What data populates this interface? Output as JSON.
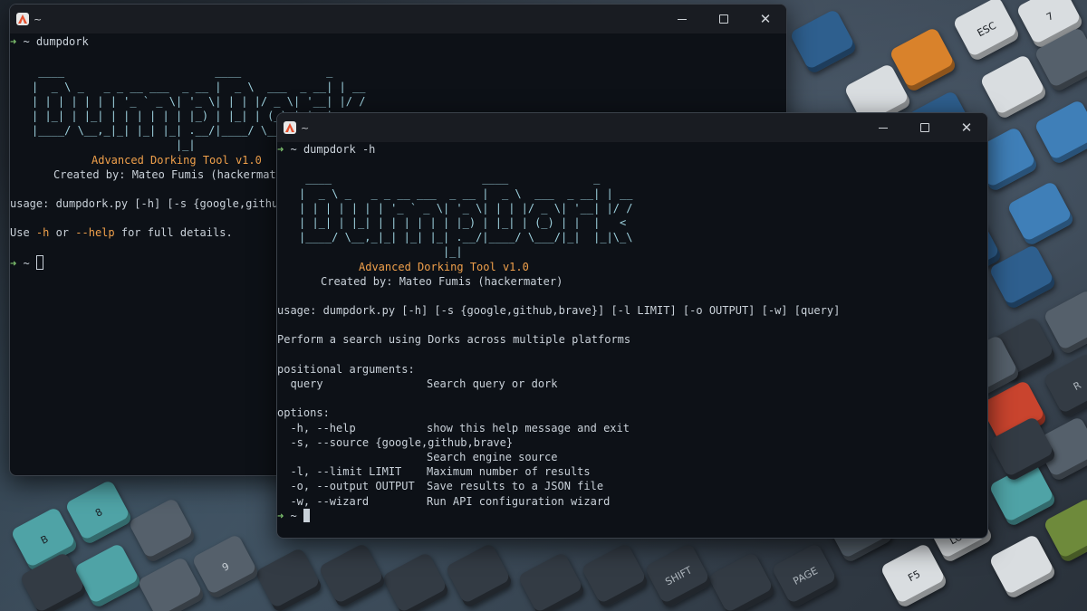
{
  "background": {
    "keys": [
      "ESC",
      "F5",
      "CAPS LOCK",
      "SHIFT",
      "PAGE",
      "R",
      "9",
      "B",
      "8",
      "7"
    ]
  },
  "win1": {
    "title": "~",
    "prompt_arrow": "➜",
    "prompt_tilde": "~",
    "command": "dumpdork",
    "art": [
      " ____                       ____             _",
      "|  _ \\ _   _ _ __ ___  _ __ |  _ \\  ___  _ __| | __",
      "| | | | | | | '_ ` _ \\| '_ \\| | | |/ _ \\| '__| |/ /",
      "| |_| | |_| | | | | | | |_) | |_| | (_) | |  |   <",
      "|____/ \\__,_|_| |_| |_| .__/|____/ \\___/|_|  |_|\\_\\",
      "                      |_|"
    ],
    "tool_name": "Advanced Dorking Tool v1.0",
    "created_by": "Created by: Mateo Fumis (hackermater)",
    "usage": "usage: dumpdork.py [-h] [-s {google,github,brave}] [-l LIMIT] [-o OUTPUT] [-w] [query]",
    "help_pre": "Use ",
    "help_h": "-h",
    "help_or": " or ",
    "help_long": "--help",
    "help_post": " for full details."
  },
  "win2": {
    "title": "~",
    "prompt_arrow": "➜",
    "prompt_tilde": "~",
    "command": "dumpdork -h",
    "art": [
      " ____                       ____             _",
      "|  _ \\ _   _ _ __ ___  _ __ |  _ \\  ___  _ __| | __",
      "| | | | | | | '_ ` _ \\| '_ \\| | | |/ _ \\| '__| |/ /",
      "| |_| | |_| | | | | | | |_) | |_| | (_) | |  |   <",
      "|____/ \\__,_|_| |_| |_| .__/|____/ \\___/|_|  |_|\\_\\",
      "                      |_|"
    ],
    "tool_name": "Advanced Dorking Tool v1.0",
    "created_by": "Created by: Mateo Fumis (hackermater)",
    "usage": "usage: dumpdork.py [-h] [-s {google,github,brave}] [-l LIMIT] [-o OUTPUT] [-w] [query]",
    "description": "Perform a search using Dorks across multiple platforms",
    "positional_header": "positional arguments:",
    "positional": [
      {
        "flag": "  query",
        "desc": "Search query or dork"
      }
    ],
    "options_header": "options:",
    "options": [
      {
        "flag": "  -h, --help",
        "desc": "show this help message and exit"
      },
      {
        "flag": "  -s, --source {google,github,brave}",
        "desc": ""
      },
      {
        "flag": "",
        "desc": "Search engine source"
      },
      {
        "flag": "  -l, --limit LIMIT",
        "desc": "Maximum number of results"
      },
      {
        "flag": "  -o, --output OUTPUT",
        "desc": "Save results to a JSON file"
      },
      {
        "flag": "  -w, --wizard",
        "desc": "Run API configuration wizard"
      }
    ]
  }
}
